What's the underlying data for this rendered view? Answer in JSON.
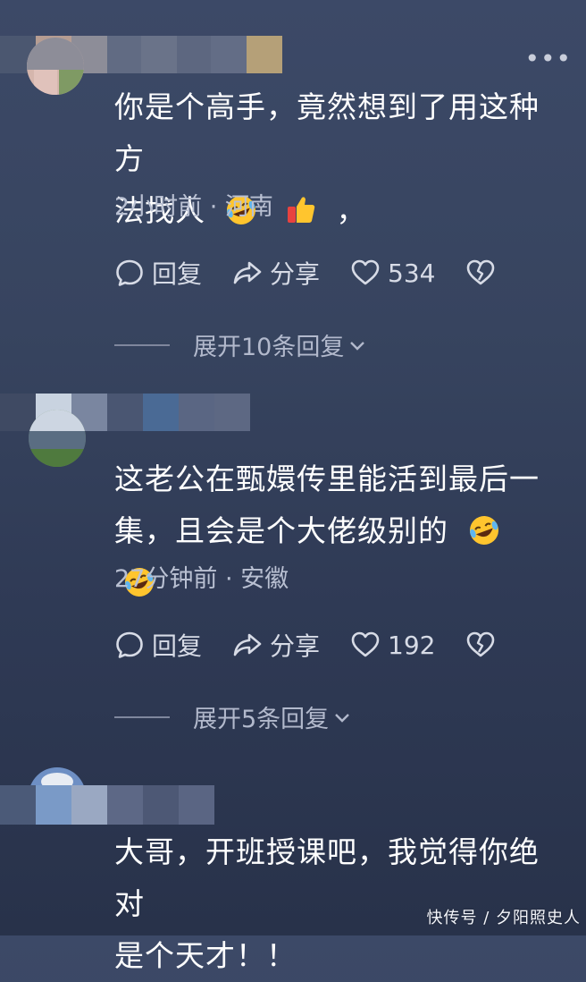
{
  "comments": [
    {
      "text_line1": "你是个高手，竟然想到了用这种方",
      "text_line2": "法找人",
      "text_tail": "，",
      "time_location": "2小时前 · 河南",
      "reply_label": "回复",
      "share_label": "分享",
      "like_count": "534",
      "expand_label": "展开10条回复"
    },
    {
      "text_line1": "这老公在甄嬛传里能活到最后一",
      "text_line2": "集，且会是个大佬级别的",
      "time_location": "27分钟前 · 安徽",
      "reply_label": "回复",
      "share_label": "分享",
      "like_count": "192",
      "expand_label": "展开5条回复"
    },
    {
      "text_line1": "大哥，开班授课吧，我觉得你绝对",
      "text_line2": "是个天才！！"
    }
  ],
  "watermark": "快传号 / 夕阳照史人",
  "colors": {
    "background_top": "#3c4967",
    "background_bottom": "#28324a",
    "emoji_yellow": "#ffc52e",
    "thumb_red": "#e8423f"
  },
  "icons": [
    "more-icon",
    "comment-icon",
    "share-icon",
    "heart-icon",
    "dislike-icon",
    "chevron-down-icon",
    "laughing-tears-emoji",
    "thumbs-up-emoji"
  ]
}
